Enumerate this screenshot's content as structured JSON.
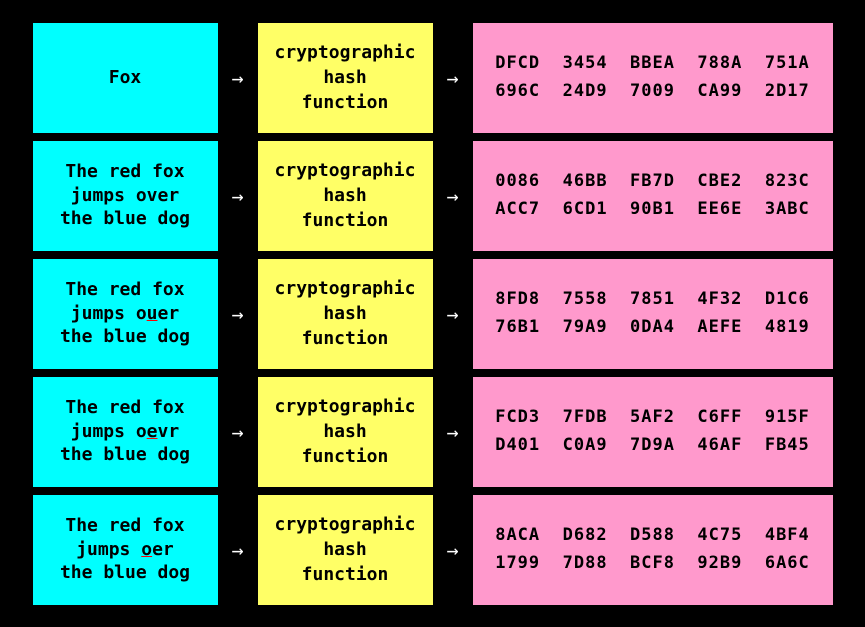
{
  "rows": [
    {
      "id": "row-1",
      "input": "Fox",
      "input_html": "Fox",
      "hash_label": "cryptographic\nhash\nfunction",
      "output_line1": "DFCD  3454  BBEA  788A  751A",
      "output_line2": "696C  24D9  7009  CA99  2D17"
    },
    {
      "id": "row-2",
      "input": "The red fox\njumps over\nthe blue dog",
      "input_html": "The red fox\njumps over\nthe blue dog",
      "hash_label": "cryptographic\nhash\nfunction",
      "output_line1": "0086  46BB  FB7D  CBE2  823C",
      "output_line2": "ACC7  6CD1  90B1  EE6E  3ABC"
    },
    {
      "id": "row-3",
      "input": "The red fox\njumps ouer\nthe blue dog",
      "input_html": "The red fox\njumps ouer\nthe blue dog",
      "hash_label": "cryptographic\nhash\nfunction",
      "output_line1": "8FD8  7558  7851  4F32  D1C6",
      "output_line2": "76B1  79A9  0DA4  AEFE  4819"
    },
    {
      "id": "row-4",
      "input": "The red fox\njumps oevr\nthe blue dog",
      "input_html": "The red fox\njumps oevr\nthe blue dog",
      "hash_label": "cryptographic\nhash\nfunction",
      "output_line1": "FCD3  7FDB  5AF2  C6FF  915F",
      "output_line2": "D401  C0A9  7D9A  46AF  FB45"
    },
    {
      "id": "row-5",
      "input": "The red fox\njumps oer\nthe blue dog",
      "input_html": "The red fox\njumps oer\nthe blue dog",
      "hash_label": "cryptographic\nhash\nfunction",
      "output_line1": "8ACA  D682  D588  4C75  4BF4",
      "output_line2": "1799  7D88  BCF8  92B9  6A6C"
    }
  ],
  "arrow_symbol": "→",
  "colors": {
    "background": "#000000",
    "input_bg": "#00FFFF",
    "hash_bg": "#FFFF66",
    "output_bg": "#FF99CC"
  }
}
